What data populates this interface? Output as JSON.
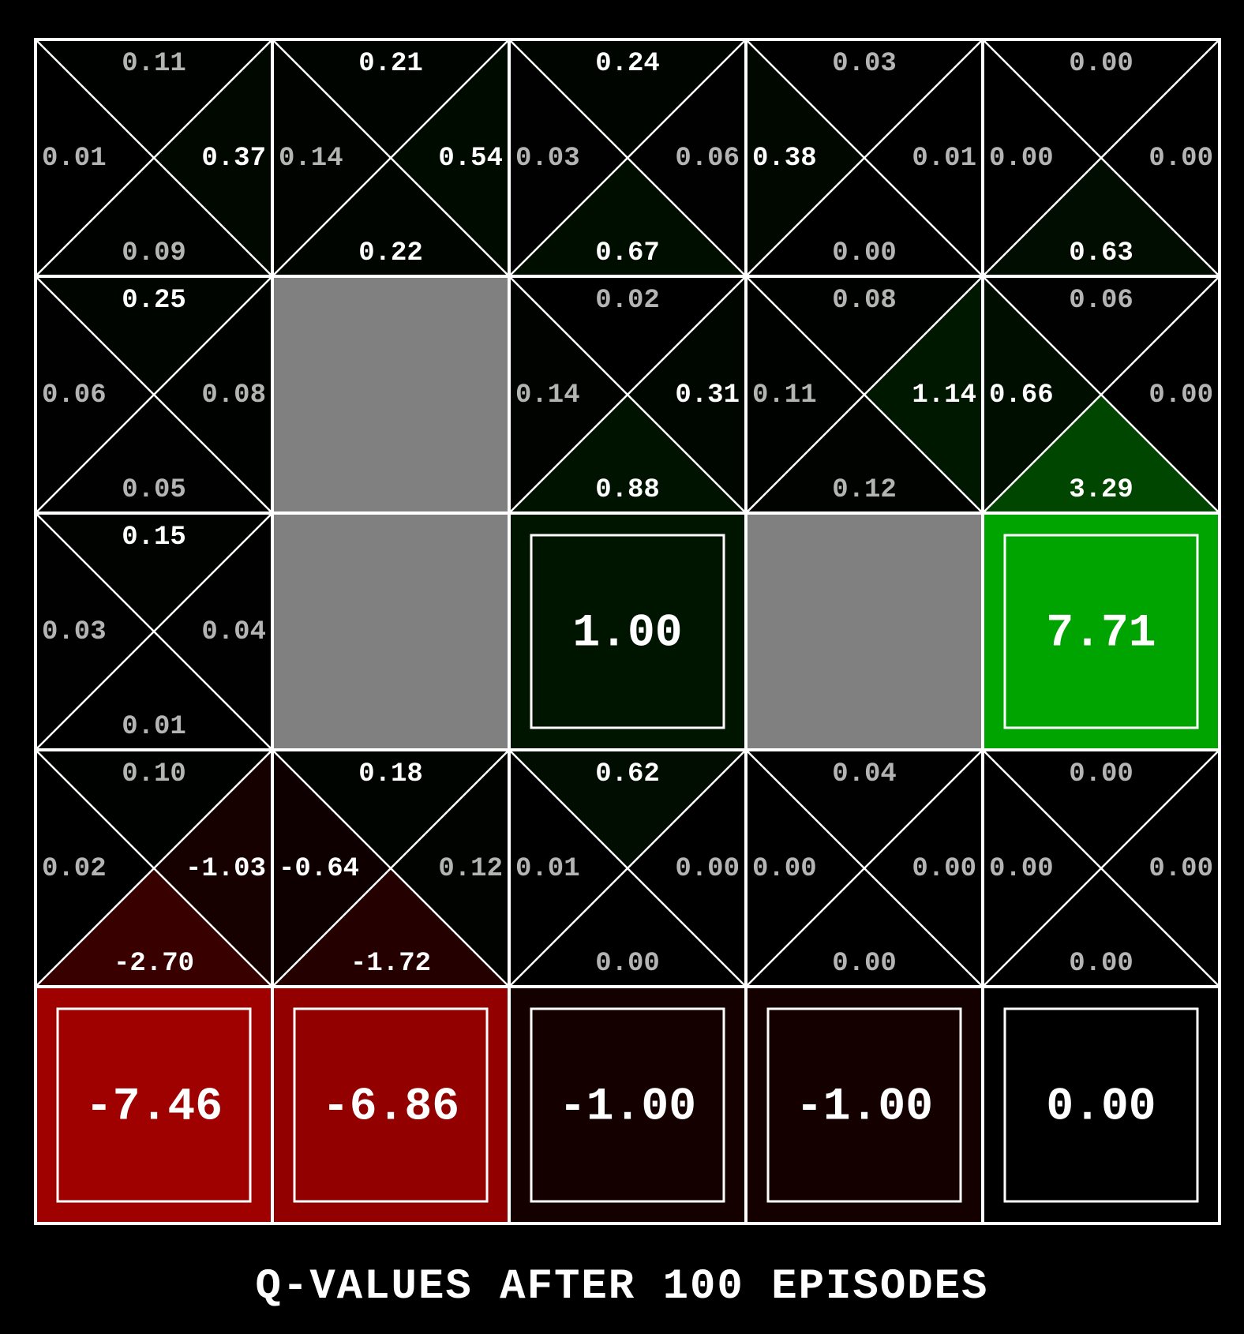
{
  "caption": "Q-VALUES AFTER 100 EPISODES",
  "colors": {
    "background": "#000000",
    "grid_lines": "#ffffff",
    "wall": "#808080",
    "dim_text": "#b4b4b4",
    "bright_text": "#ffffff",
    "positive": "#00aa00",
    "negative": "#aa0000"
  },
  "grid": {
    "rows": 5,
    "cols": 5,
    "cells": [
      [
        {
          "type": "q",
          "values": {
            "n": "0.11",
            "e": "0.37",
            "s": "0.09",
            "w": "0.01"
          }
        },
        {
          "type": "q",
          "values": {
            "n": "0.21",
            "e": "0.54",
            "s": "0.22",
            "w": "0.14"
          }
        },
        {
          "type": "q",
          "values": {
            "n": "0.24",
            "e": "0.06",
            "s": "0.67",
            "w": "0.03"
          }
        },
        {
          "type": "q",
          "values": {
            "n": "0.03",
            "e": "0.01",
            "s": "0.00",
            "w": "0.38"
          }
        },
        {
          "type": "q",
          "values": {
            "n": "0.00",
            "e": "0.00",
            "s": "0.63",
            "w": "0.00"
          }
        }
      ],
      [
        {
          "type": "q",
          "values": {
            "n": "0.25",
            "e": "0.08",
            "s": "0.05",
            "w": "0.06"
          }
        },
        {
          "type": "wall"
        },
        {
          "type": "q",
          "values": {
            "n": "0.02",
            "e": "0.31",
            "s": "0.88",
            "w": "0.14"
          }
        },
        {
          "type": "q",
          "values": {
            "n": "0.08",
            "e": "1.14",
            "s": "0.12",
            "w": "0.11"
          }
        },
        {
          "type": "q",
          "values": {
            "n": "0.06",
            "e": "0.00",
            "s": "3.29",
            "w": "0.66"
          }
        }
      ],
      [
        {
          "type": "q",
          "values": {
            "n": "0.15",
            "e": "0.04",
            "s": "0.01",
            "w": "0.03"
          }
        },
        {
          "type": "wall"
        },
        {
          "type": "terminal",
          "value": "1.00"
        },
        {
          "type": "wall"
        },
        {
          "type": "terminal",
          "value": "7.71"
        }
      ],
      [
        {
          "type": "q",
          "values": {
            "n": "0.10",
            "e": "-1.03",
            "s": "-2.70",
            "w": "0.02"
          }
        },
        {
          "type": "q",
          "values": {
            "n": "0.18",
            "e": "0.12",
            "s": "-1.72",
            "w": "-0.64"
          }
        },
        {
          "type": "q",
          "values": {
            "n": "0.62",
            "e": "0.00",
            "s": "0.00",
            "w": "0.01"
          }
        },
        {
          "type": "q",
          "values": {
            "n": "0.04",
            "e": "0.00",
            "s": "0.00",
            "w": "0.00"
          }
        },
        {
          "type": "q",
          "values": {
            "n": "0.00",
            "e": "0.00",
            "s": "0.00",
            "w": "0.00"
          }
        }
      ],
      [
        {
          "type": "terminal",
          "value": "-7.46"
        },
        {
          "type": "terminal",
          "value": "-6.86"
        },
        {
          "type": "terminal",
          "value": "-1.00"
        },
        {
          "type": "terminal",
          "value": "-1.00"
        },
        {
          "type": "terminal",
          "value": "0.00"
        }
      ]
    ]
  }
}
